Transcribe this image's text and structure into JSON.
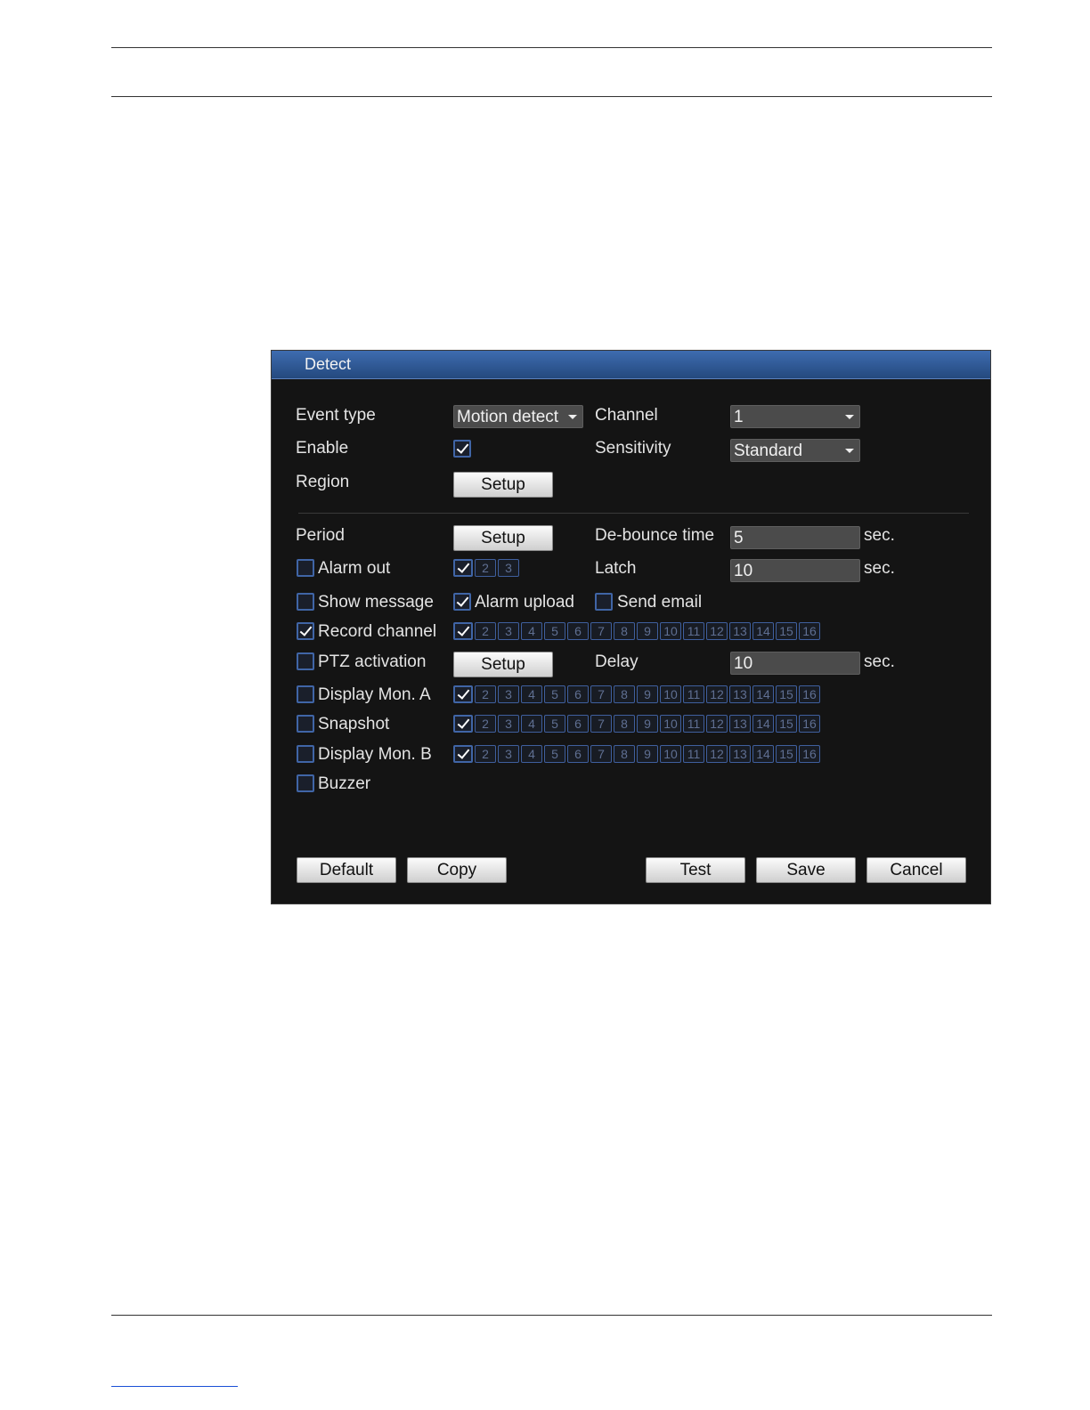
{
  "dialog": {
    "title": "Detect"
  },
  "top": {
    "event_type_label": "Event type",
    "event_type_value": "Motion detect",
    "channel_label": "Channel",
    "channel_value": "1",
    "enable_label": "Enable",
    "enable_checked": true,
    "sensitivity_label": "Sensitivity",
    "sensitivity_value": "Standard",
    "region_label": "Region",
    "region_button": "Setup"
  },
  "events": {
    "period_label": "Period",
    "period_button": "Setup",
    "debounce_label": "De-bounce time",
    "debounce_value": "5",
    "debounce_unit": "sec.",
    "alarm_out_label": "Alarm out",
    "alarm_out_channels": [
      "2",
      "3"
    ],
    "latch_label": "Latch",
    "latch_value": "10",
    "latch_unit": "sec.",
    "show_message_label": "Show message",
    "alarm_upload_label": "Alarm upload",
    "send_email_label": "Send email",
    "record_channel_label": "Record channel",
    "ptz_activation_label": "PTZ activation",
    "ptz_button": "Setup",
    "delay_label": "Delay",
    "delay_value": "10",
    "delay_unit": "sec.",
    "display_mon_a_label": "Display Mon. A",
    "snapshot_label": "Snapshot",
    "display_mon_b_label": "Display Mon. B",
    "buzzer_label": "Buzzer",
    "channels": [
      "2",
      "3",
      "4",
      "5",
      "6",
      "7",
      "8",
      "9",
      "10",
      "11",
      "12",
      "13",
      "14",
      "15",
      "16"
    ]
  },
  "footer": {
    "default": "Default",
    "copy": "Copy",
    "test": "Test",
    "save": "Save",
    "cancel": "Cancel"
  },
  "colors": {
    "title_bar": "#2f5a96",
    "background": "#141414",
    "checkbox_border": "#4065a6"
  }
}
